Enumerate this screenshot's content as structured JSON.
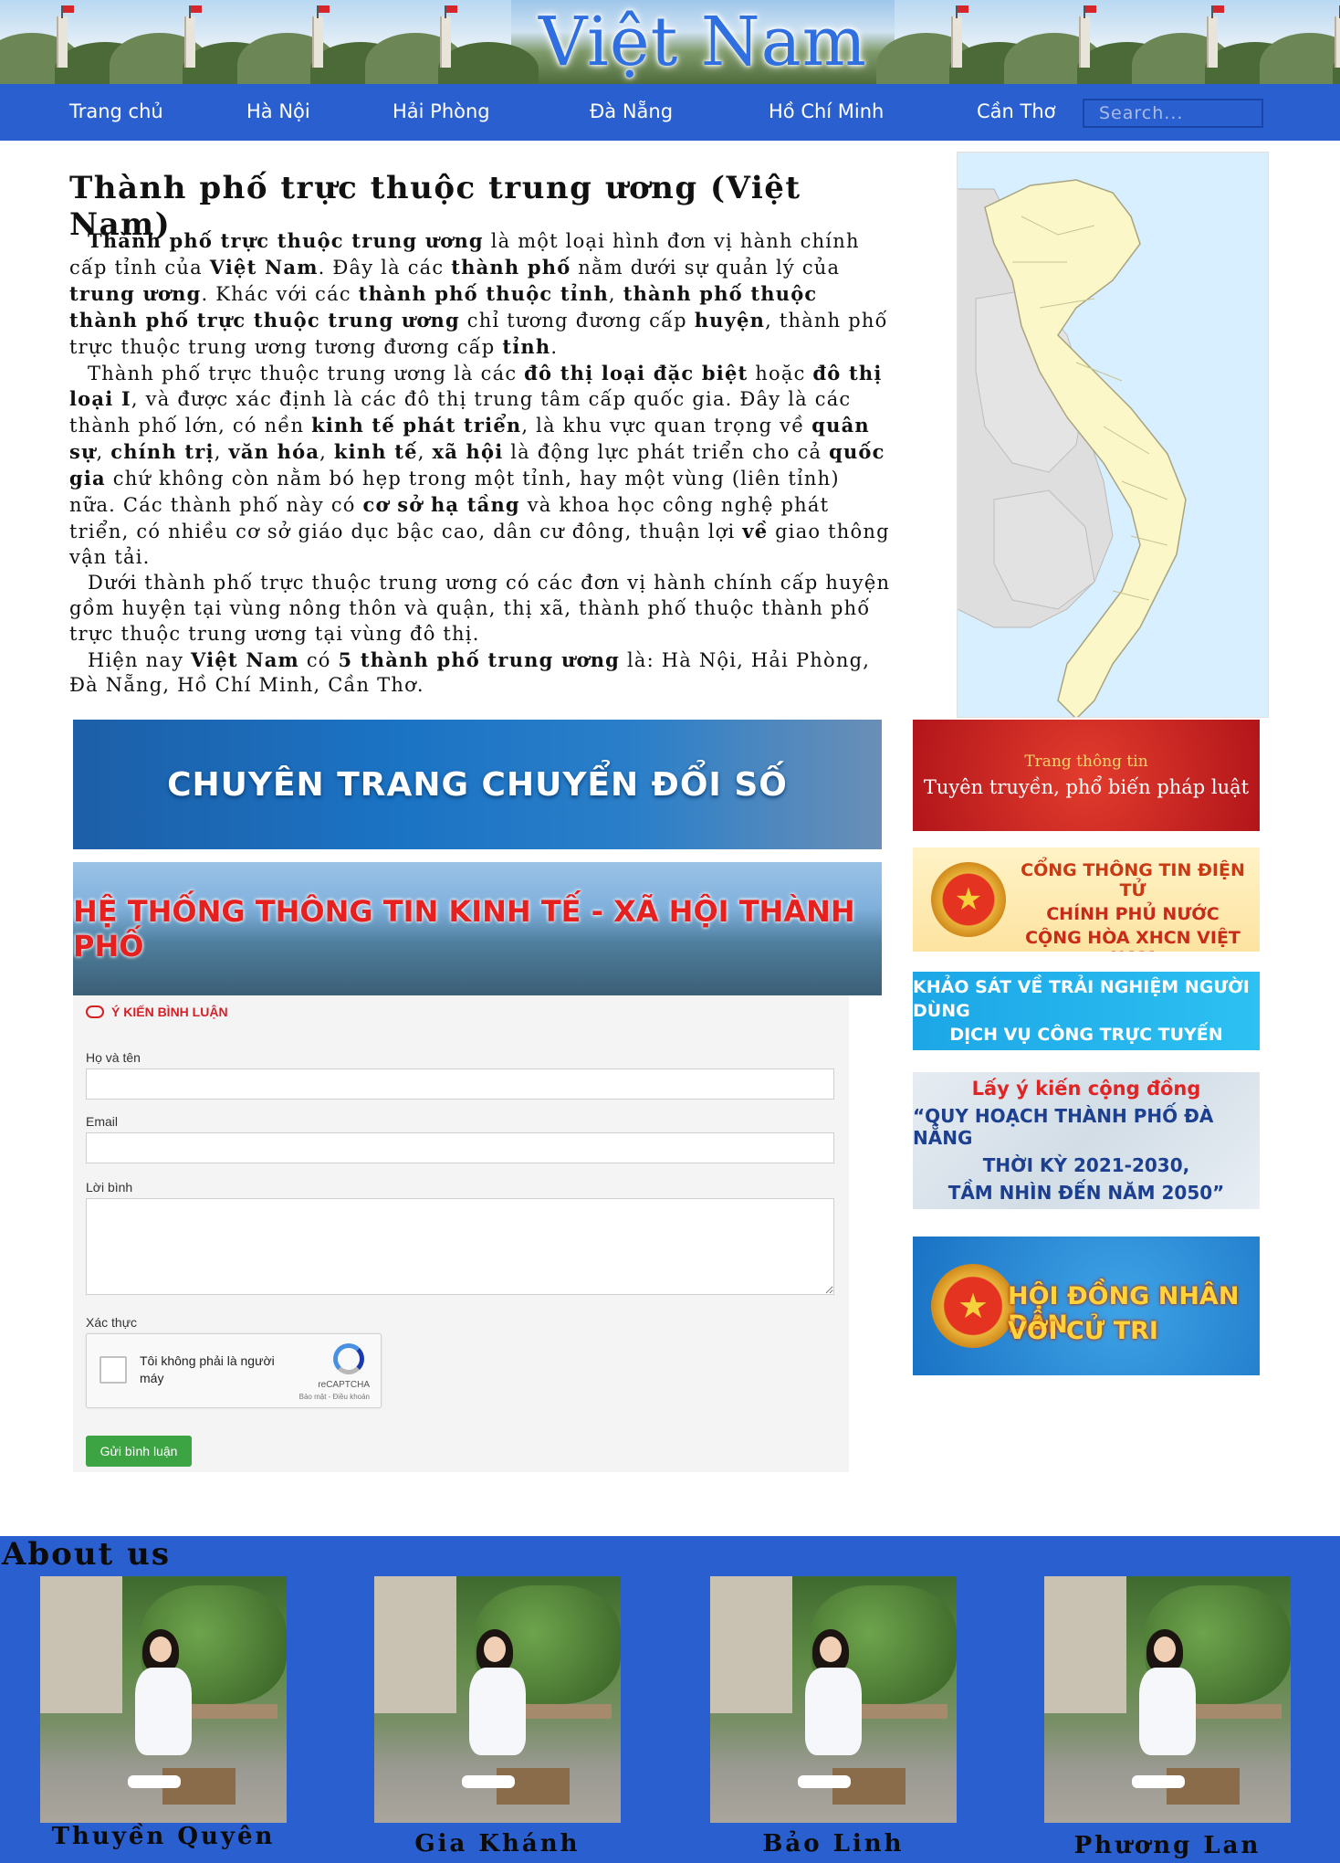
{
  "header": {
    "title": "Việt Nam"
  },
  "nav": {
    "items": [
      "Trang chủ",
      "Hà Nội",
      "Hải Phòng",
      "Đà Nẵng",
      "Hồ Chí Minh",
      "Cần Thơ"
    ],
    "search_placeholder": "Search..."
  },
  "article": {
    "title": "Thành phố trực thuộc trung ương (Việt Nam)"
  },
  "banners": {
    "chuyen_doi_so": "CHUYÊN TRANG CHUYỂN ĐỔI SỐ",
    "kinh_te": "HỆ THỐNG THÔNG TIN KINH TẾ - XÃ HỘI THÀNH PHỐ",
    "tuyen_truyen_line1": "Trang thông tin",
    "tuyen_truyen_line2": "Tuyên truyền, phổ biến pháp luật",
    "chinh_phu_line1": "CỔNG THÔNG TIN ĐIỆN TỬ",
    "chinh_phu_line2": "CHÍNH PHỦ NƯỚC",
    "chinh_phu_line3": "CỘNG HÒA XHCN VIỆT NAM",
    "khao_sat_line1": "KHẢO SÁT VỀ TRẢI NGHIỆM NGƯỜI DÙNG",
    "khao_sat_line2": "DỊCH VỤ CÔNG TRỰC TUYẾN",
    "quy_hoach_line1": "Lấy ý kiến cộng đồng",
    "quy_hoach_line2": "“QUY HOẠCH THÀNH PHỐ ĐÀ NẴNG",
    "quy_hoach_line3": "THỜI KỲ 2021-2030,",
    "quy_hoach_line4": "TẦM NHÌN ĐẾN NĂM 2050”",
    "hdnd_line1": "HỘI ĐỒNG NHÂN DÂN",
    "hdnd_line2": "VỚI CỬ TRI"
  },
  "comment_form": {
    "heading": "Ý KIẾN BÌNH LUẬN",
    "name_label": "Họ và tên",
    "email_label": "Email",
    "comment_label": "Lời bình",
    "verify_label": "Xác thực",
    "captcha_text": "Tôi không phải là người máy",
    "captcha_brand": "reCAPTCHA",
    "captcha_links": "Bảo mật - Điều khoản",
    "submit_label": "Gửi bình luận"
  },
  "about": {
    "title": "About us",
    "members": [
      "Thuyền Quyên",
      "Gia Khánh",
      "Bảo Linh",
      "Phương Lan"
    ]
  },
  "colors": {
    "nav_blue": "#2a5fd0",
    "title_blue": "#2f6fe0",
    "submit_green": "#3da443",
    "comment_red": "#d42027"
  }
}
